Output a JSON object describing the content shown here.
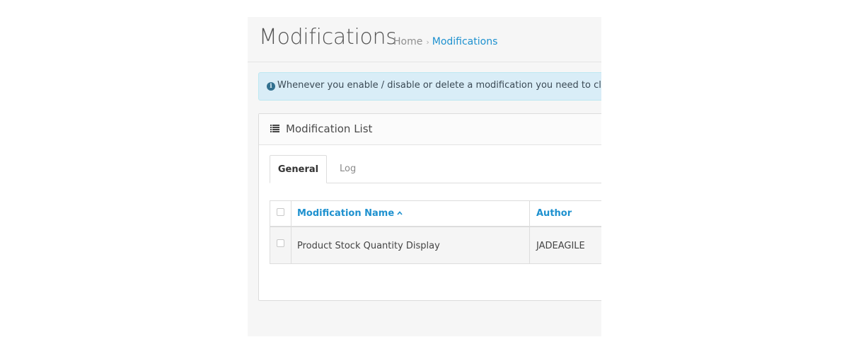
{
  "header": {
    "title": "Modifications",
    "breadcrumb": {
      "home": "Home",
      "separator": "›",
      "current": "Modifications"
    }
  },
  "alert": {
    "icon": "info-circle-icon",
    "text": "Whenever you enable / disable or delete a modification you need to click the refresh button to rebuild your modification cache!"
  },
  "panel": {
    "icon": "list-icon",
    "title": "Modification List",
    "tabs": [
      {
        "label": "General",
        "active": true
      },
      {
        "label": "Log",
        "active": false
      }
    ],
    "table": {
      "columns": [
        {
          "label": "Modification Name",
          "sort": "asc"
        },
        {
          "label": "Author"
        }
      ],
      "rows": [
        {
          "name": "Product Stock Quantity Display",
          "author": "JADEAGILE",
          "checked": false
        }
      ]
    }
  },
  "colors": {
    "link": "#1e91cf",
    "alert_bg": "#d9edf7",
    "page_bg": "#f6f6f6"
  }
}
